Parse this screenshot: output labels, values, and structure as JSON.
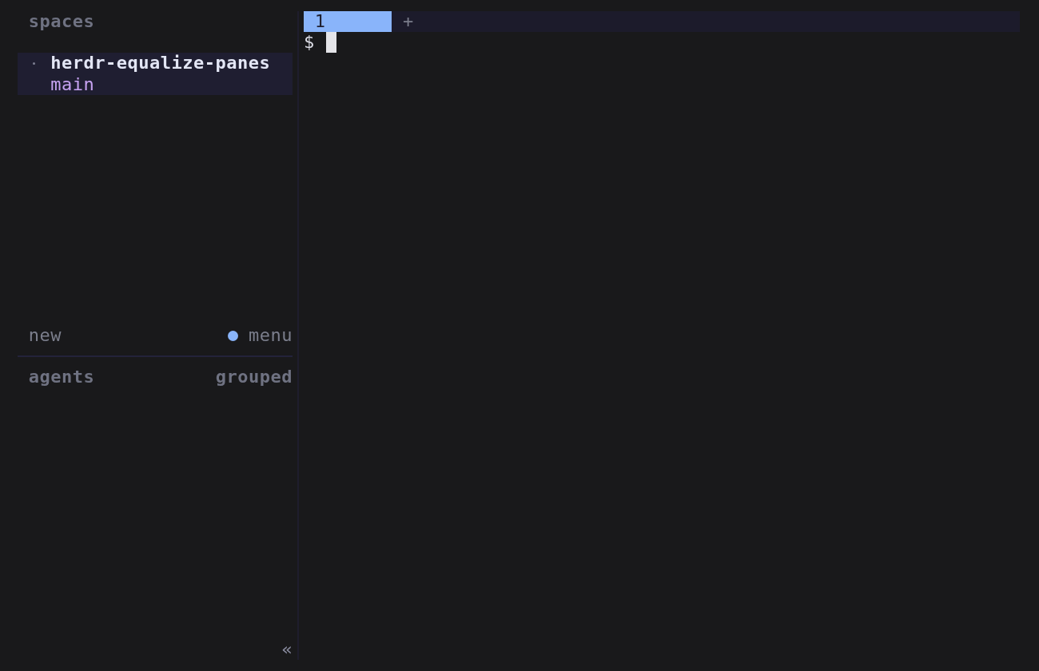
{
  "sidebar": {
    "spaces_header": "spaces",
    "spaces": [
      {
        "name": "herdr-equalize-panes",
        "branch": "main",
        "selected": true
      }
    ],
    "new_label": "new",
    "menu_label": "menu",
    "agents_header": "agents",
    "agents_mode": "grouped",
    "collapse": "«"
  },
  "tabs": [
    {
      "label": "1",
      "selected": true
    }
  ],
  "new_tab": "+",
  "terminal": {
    "prompt": "$"
  }
}
